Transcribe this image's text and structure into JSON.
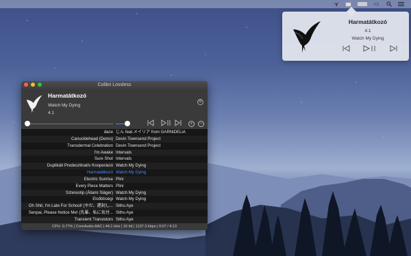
{
  "menubar": {
    "icons": [
      "bird-menu-icon",
      "box-menu-icon",
      "bar-menu-icon",
      "display-menu-icon",
      "search-icon",
      "list-icon"
    ]
  },
  "popover": {
    "track": "Harmatátkozó",
    "rating": "4.1",
    "artist": "Watch My Dying",
    "controls": {
      "prev": "⏮",
      "play": "▷||",
      "next": "⏭"
    }
  },
  "window": {
    "title": "Colibri Lossless",
    "now_playing": {
      "track": "Harmatátkozó",
      "artist": "Watch My Dying",
      "rating": "4.1"
    },
    "controls": {
      "prev": "|◁",
      "play": "▷||",
      "next": "▷|",
      "add": "+",
      "remove": "−"
    },
    "playback": {
      "progress_fraction": 0.02,
      "volume_fraction": 0.9
    },
    "playlist": [
      {
        "title": "daze",
        "artist": "じん feat.メイリア from GARNiDELiA"
      },
      {
        "title": "Canucklehead (Demo)",
        "artist": "Devin Townsend Project"
      },
      {
        "title": "Transdermal Celebration",
        "artist": "Devin Townsend Project"
      },
      {
        "title": "I'm Awake",
        "artist": "Intervals"
      },
      {
        "title": "Sure Shot",
        "artist": "Intervals"
      },
      {
        "title": "Duplikált Predesztinatív Kooperáció",
        "artist": "Watch My Dying"
      },
      {
        "title": "Harmatátkozó",
        "artist": "Watch My Dying",
        "current": true
      },
      {
        "title": "Electric Sunrise",
        "artist": "Plini"
      },
      {
        "title": "Every Piece Matters",
        "artist": "Plini"
      },
      {
        "title": "Sztereotip (Állami Sláger)",
        "artist": "Watch My Dying"
      },
      {
        "title": "Elsőbbségi",
        "artist": "Watch My Dying"
      },
      {
        "title": "Oh Shit, I'm Late For School! (やだ、遅刻し...",
        "artist": "Sithu Aye"
      },
      {
        "title": "Senpai, Please Notice Me! (先輩、私に気付...",
        "artist": "Sithu Aye"
      },
      {
        "title": "Transient Transistors",
        "artist": "Sithu Aye"
      }
    ],
    "status": "CPU: 0.77% | CoreAudio AAC | 44.1 kHz | 16 bit | 1137.3 kbps | 0:07 / 4:13"
  },
  "colors": {
    "accent": "#4a8ff7",
    "current_row": "#4a8ff7",
    "volume": "#3d8bfd"
  }
}
